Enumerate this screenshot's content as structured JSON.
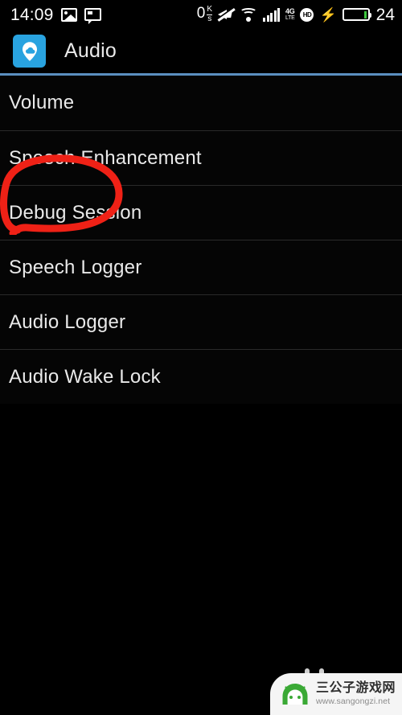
{
  "status_bar": {
    "time": "14:09",
    "left_icons": [
      "photo-icon",
      "chat-icon"
    ],
    "net_rate": "0",
    "net_rate_unit_top": "K",
    "net_rate_unit_bottom": "s",
    "icons": [
      "mute-icon",
      "wifi-icon",
      "signal-bars-icon",
      "4g-lte-icon",
      "hd-icon",
      "charging-bolt-icon",
      "battery-icon"
    ],
    "network_type_top": "4G",
    "network_type_bottom": "LTE",
    "hd_label": "HD",
    "battery_percent": "24",
    "battery_level": 24,
    "battery_color": "#3ec63e"
  },
  "title_bar": {
    "app_icon": "audio-app-icon",
    "icon_bg_color": "#29a3e0",
    "title": "Audio"
  },
  "divider_color": "#5b8fc0",
  "list": {
    "items": [
      {
        "label": "Volume"
      },
      {
        "label": "Speech Enhancement"
      },
      {
        "label": "Debug Session"
      },
      {
        "label": "Speech Logger"
      },
      {
        "label": "Audio Logger"
      },
      {
        "label": "Audio Wake Lock"
      }
    ]
  },
  "annotation": {
    "type": "hand-drawn-circle",
    "target": "Volume",
    "color": "#ef2116"
  },
  "watermark": {
    "site_name": "三公子游戏网",
    "url": "www.sangongzi.net",
    "logo": "android-robot-icon",
    "logo_color": "#3aa935"
  }
}
